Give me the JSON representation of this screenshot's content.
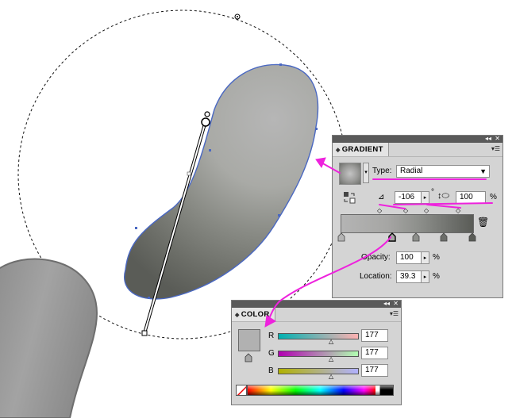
{
  "gradient_panel": {
    "title": "GRADIENT",
    "type_label": "Type:",
    "type_value": "Radial",
    "angle_value": "-106",
    "angle_unit": "°",
    "aspect_value": "100",
    "aspect_unit": "%",
    "opacity_label": "Opacity:",
    "opacity_value": "100",
    "opacity_unit": "%",
    "location_label": "Location:",
    "location_value": "39.3",
    "location_unit": "%"
  },
  "color_panel": {
    "title": "COLOR",
    "r_label": "R",
    "r_value": "177",
    "g_label": "G",
    "g_value": "177",
    "b_label": "B",
    "b_value": "177"
  },
  "colors": {
    "annotation": "#ee22dd",
    "path_stroke": "#4a68c2",
    "panel_bg": "#d4d4d4",
    "swatch_gray": "#b1b1b1"
  },
  "icons": [
    "collapse-arrows-icon",
    "close-icon",
    "panel-menu-icon",
    "reverse-gradient-icon",
    "angle-icon",
    "aspect-ratio-icon",
    "trash-icon",
    "dropdown-arrow-icon",
    "none-swatch-icon",
    "out-of-gamut-icon"
  ]
}
